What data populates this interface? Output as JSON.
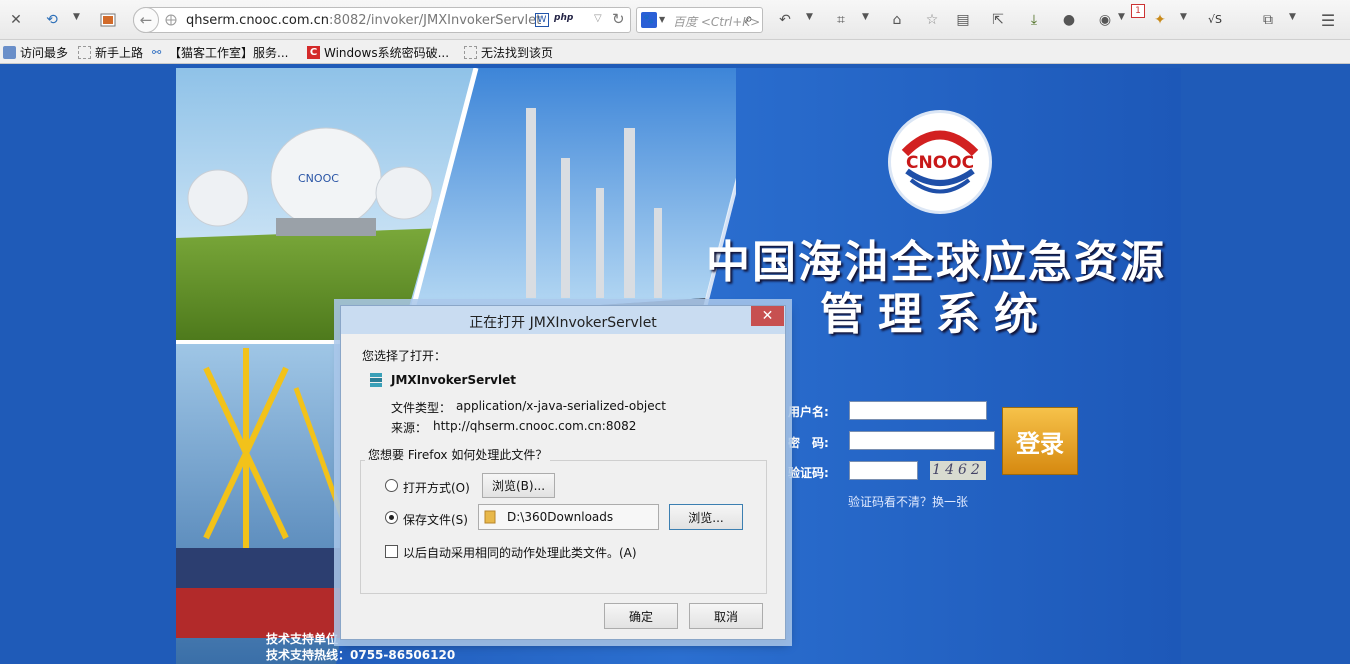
{
  "browser": {
    "url": "qhserm.cnooc.com.cn:8082/invoker/JMXInvokerServlet",
    "url_host": "qhserm.cnooc.com.cn",
    "url_rest": ":8082/invoker/JMXInvokerServlet",
    "search_placeholder": "百度 <Ctrl+K>",
    "php_badge": "php",
    "notification_count": "1",
    "profile_label": "√S"
  },
  "bookmarks": [
    {
      "label": "访问最多"
    },
    {
      "label": "新手上路"
    },
    {
      "label": "【猫客工作室】服务..."
    },
    {
      "label": "Windows系统密码破..."
    },
    {
      "label": "无法找到该页"
    }
  ],
  "page": {
    "logo_text": "CNOOC",
    "title_line1": "中国海油全球应急资源",
    "title_line2": "管理系统",
    "username_label": "用户名:",
    "password_label": "密　码:",
    "captcha_label": "验证码:",
    "captcha_value": "1462",
    "login_button": "登录",
    "refresh_captcha": "验证码看不清？换一张",
    "support_unit": "技术支持单位",
    "support_hotline": "技术支持热线：0755-86506120",
    "tank_text": "CNOOC"
  },
  "dialog": {
    "title": "正在打开 JMXInvokerServlet",
    "you_chose": "您选择了打开：",
    "file_name": "JMXInvokerServlet",
    "file_type_label": "文件类型：",
    "file_type_value": "application/x-java-serialized-object",
    "source_label": "来源：",
    "source_value": "http://qhserm.cnooc.com.cn:8082",
    "question": "您想要 Firefox 如何处理此文件？",
    "open_with_label": "打开方式(O)",
    "browse_b_label": "浏览(B)...",
    "save_file_label": "保存文件(S)",
    "save_path": "D:\\360Downloads",
    "browse_label": "浏览...",
    "auto_label": "以后自动采用相同的动作处理此类文件。(A)",
    "ok_label": "确定",
    "cancel_label": "取消",
    "selected_option": "save_file",
    "auto_checked": false
  }
}
